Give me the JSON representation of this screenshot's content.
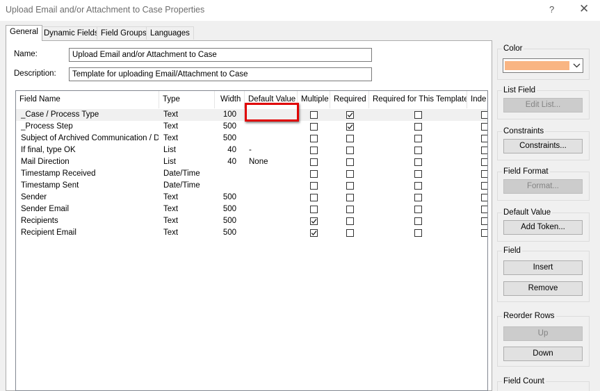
{
  "window": {
    "title": "Upload Email and/or Attachment to Case Properties",
    "help": "?",
    "close": "✕"
  },
  "tabs": [
    {
      "label": "General"
    },
    {
      "label": "Dynamic Fields"
    },
    {
      "label": "Field Groups"
    },
    {
      "label": "Languages"
    }
  ],
  "form": {
    "name_label": "Name:",
    "name_value": "Upload Email and/or Attachment to Case",
    "description_label": "Description:",
    "description_value": "Template for uploading Email/Attachment to Case"
  },
  "grid": {
    "columns": [
      "Field Name",
      "Type",
      "Width",
      "Default Value",
      "Multiple",
      "Required",
      "Required for This Template",
      "Inde"
    ],
    "rows": [
      {
        "name": "_Case / Process Type",
        "type": "Text",
        "width": "100",
        "default": "",
        "multiple": false,
        "required": true,
        "required_template": false
      },
      {
        "name": "_Process Step",
        "type": "Text",
        "width": "500",
        "default": "",
        "multiple": false,
        "required": true,
        "required_template": false
      },
      {
        "name": "Subject of Archived Communication / Doc",
        "type": "Text",
        "width": "500",
        "default": "",
        "multiple": false,
        "required": false,
        "required_template": false
      },
      {
        "name": "If final, type OK",
        "type": "List",
        "width": "40",
        "default": "-",
        "multiple": false,
        "required": false,
        "required_template": false
      },
      {
        "name": "Mail Direction",
        "type": "List",
        "width": "40",
        "default": "None",
        "multiple": false,
        "required": false,
        "required_template": false
      },
      {
        "name": "Timestamp Received",
        "type": "Date/Time",
        "width": "",
        "default": "",
        "multiple": false,
        "required": false,
        "required_template": false
      },
      {
        "name": "Timestamp Sent",
        "type": "Date/Time",
        "width": "",
        "default": "",
        "multiple": false,
        "required": false,
        "required_template": false
      },
      {
        "name": "Sender",
        "type": "Text",
        "width": "500",
        "default": "",
        "multiple": false,
        "required": false,
        "required_template": false
      },
      {
        "name": "Sender Email",
        "type": "Text",
        "width": "500",
        "default": "",
        "multiple": false,
        "required": false,
        "required_template": false
      },
      {
        "name": "Recipients",
        "type": "Text",
        "width": "500",
        "default": "",
        "multiple": true,
        "required": false,
        "required_template": false
      },
      {
        "name": "Recipient Email",
        "type": "Text",
        "width": "500",
        "default": "",
        "multiple": true,
        "required": false,
        "required_template": false
      }
    ]
  },
  "sidebar": {
    "color_label": "Color",
    "color_value": "#f9b583",
    "list_field_label": "List Field",
    "edit_list_button": "Edit List...",
    "constraints_label": "Constraints",
    "constraints_button": "Constraints...",
    "field_format_label": "Field Format",
    "format_button": "Format...",
    "default_value_label": "Default Value",
    "add_token_button": "Add Token...",
    "field_label": "Field",
    "insert_button": "Insert",
    "remove_button": "Remove",
    "reorder_label": "Reorder Rows",
    "up_button": "Up",
    "down_button": "Down",
    "field_count_label": "Field Count"
  },
  "colors": {
    "highlight": "#e00000",
    "selected_row": "#f0f0f0"
  }
}
